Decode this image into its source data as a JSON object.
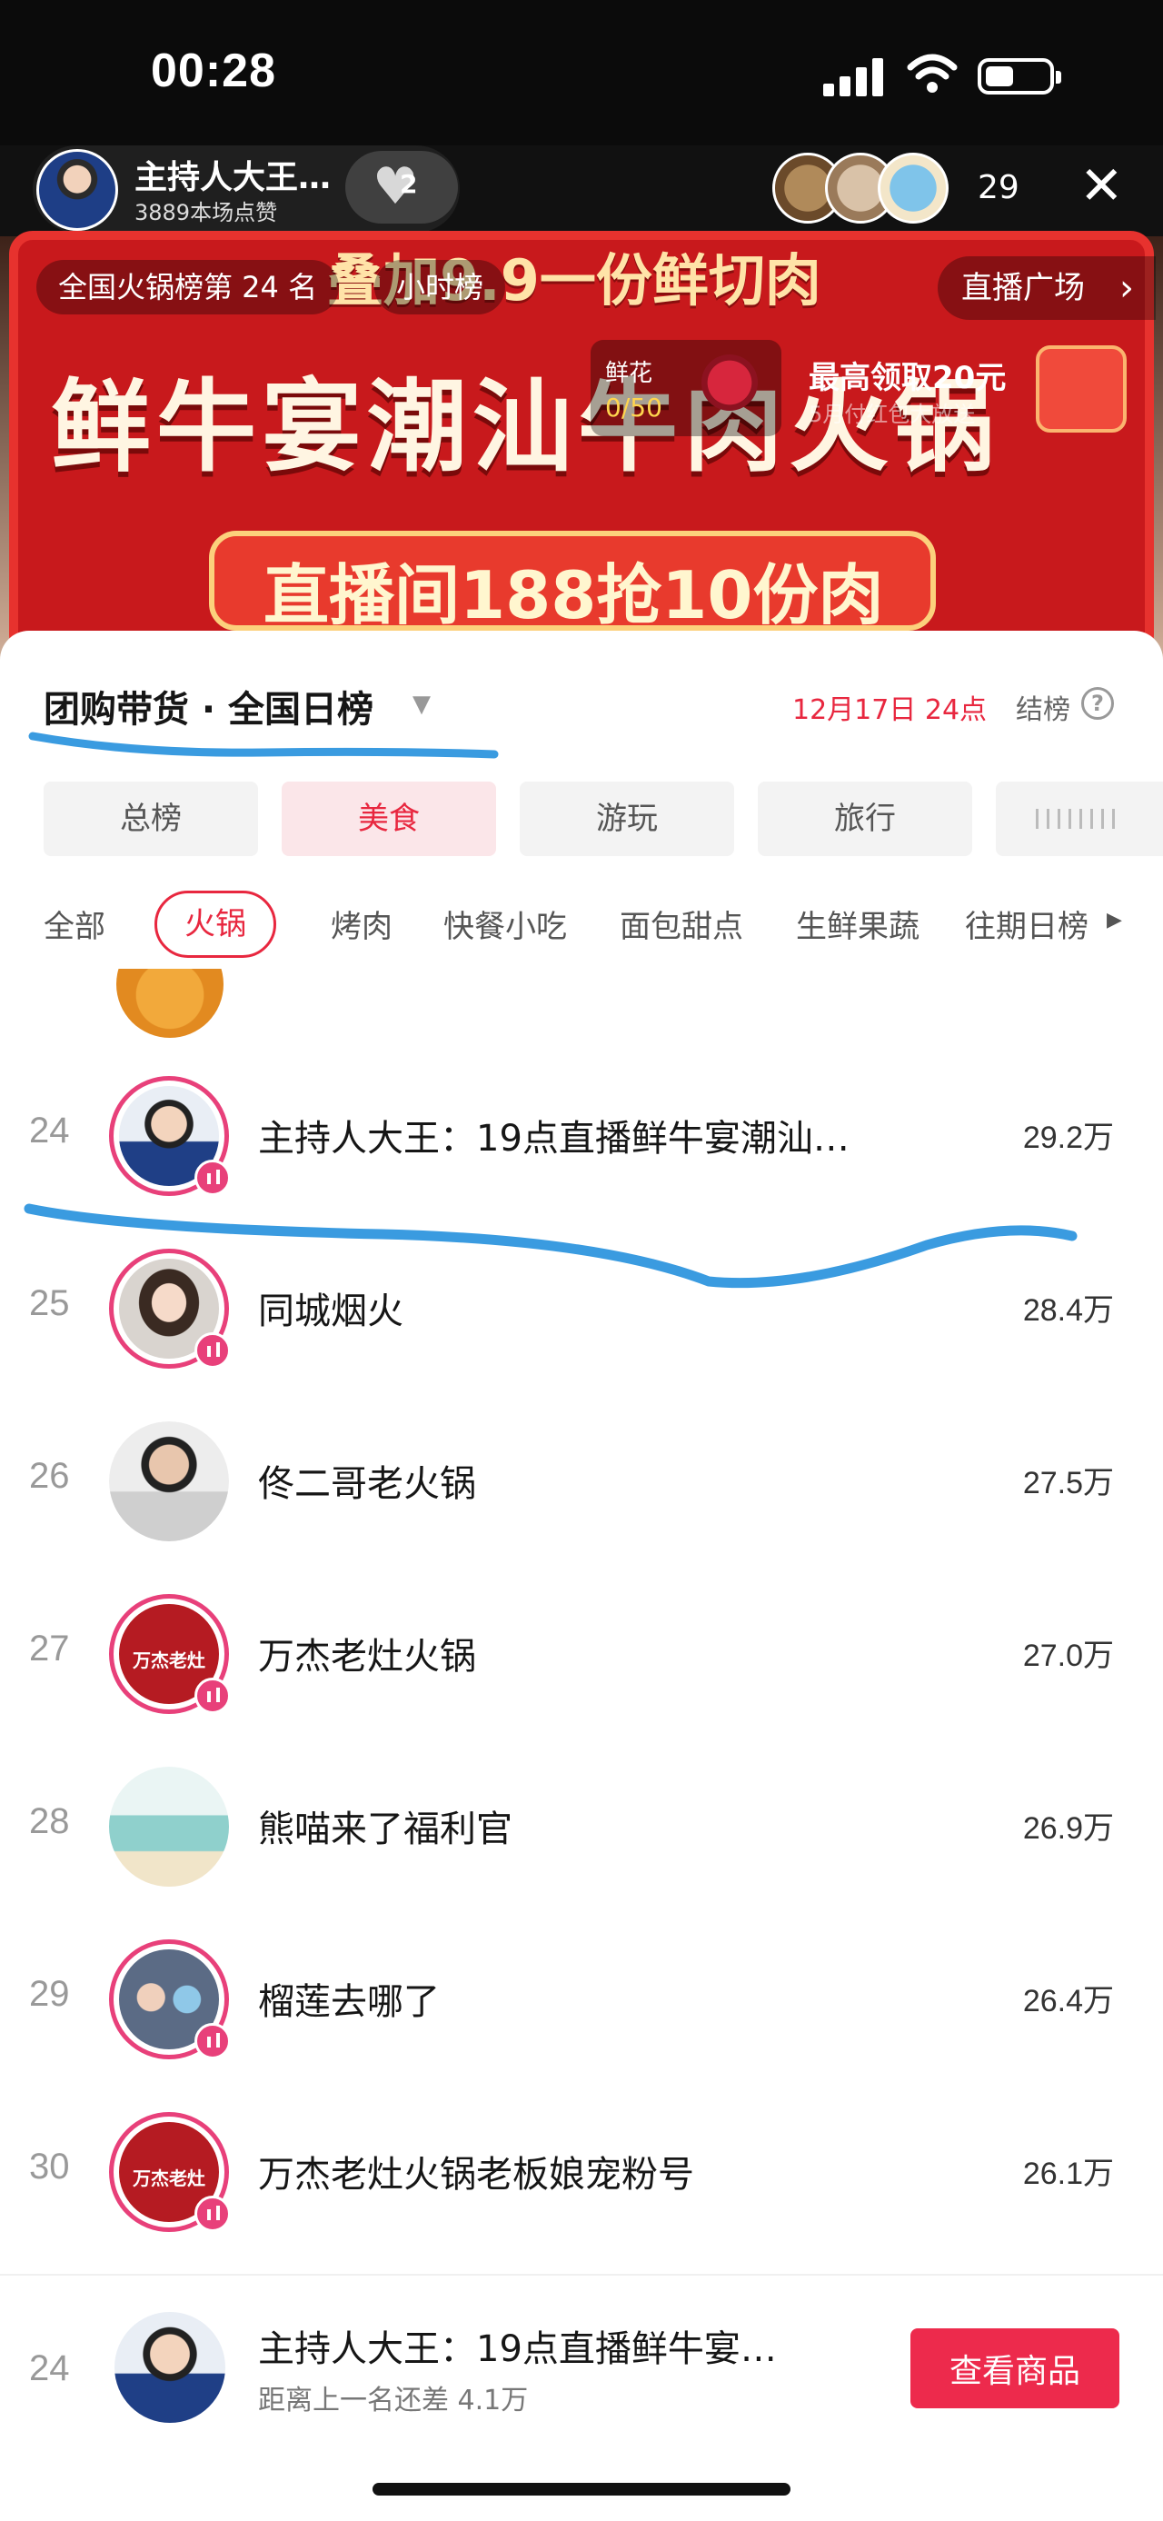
{
  "status_bar": {
    "time": "00:28"
  },
  "live": {
    "host_name": "主持人大王…",
    "likes": "3889本场点赞",
    "gift_count": "2",
    "viewer_count": "29",
    "rank_chip": "全国火锅榜第 24 名",
    "hour_chip": "小时榜",
    "plaza": "直播广场",
    "banner_top": "叠加9.9一份鲜切肉",
    "banner_main": "鲜牛宴潮汕牛肉火锅",
    "banner_bottom": "直播间188抢10份肉",
    "flower_label": "鲜花",
    "flower_count": "0/50",
    "redpack_title": "最高领取20元",
    "redpack_sub": "5月付红包大放送"
  },
  "panel": {
    "title": "团购带货 · 全国日榜",
    "date": "12月17日 24点",
    "settle": "结榜",
    "help": "?",
    "categories": [
      "总榜",
      "美食",
      "游玩",
      "旅行"
    ],
    "active_category": "美食",
    "subcategories": [
      "全部",
      "火锅",
      "烤肉",
      "快餐小吃",
      "面包甜点",
      "生鲜果蔬",
      "往期日榜"
    ],
    "active_subcategory": "火锅",
    "past_chevron": "▶"
  },
  "rows": [
    {
      "rank": "24",
      "name": "主持人大王：19点直播鲜牛宴潮汕…",
      "score": "29.2万",
      "live": true,
      "avatar": "host"
    },
    {
      "rank": "25",
      "name": "同城烟火",
      "score": "28.4万",
      "live": true,
      "avatar": "woman"
    },
    {
      "rank": "26",
      "name": "佟二哥老火锅",
      "score": "27.5万",
      "live": false,
      "avatar": "man"
    },
    {
      "rank": "27",
      "name": "万杰老灶火锅",
      "score": "27.0万",
      "live": true,
      "avatar": "wanjie",
      "logo_text": "万杰老灶"
    },
    {
      "rank": "28",
      "name": "熊喵来了福利官",
      "score": "26.9万",
      "live": false,
      "avatar": "xiongmiao"
    },
    {
      "rank": "29",
      "name": "榴莲去哪了",
      "score": "26.4万",
      "live": true,
      "avatar": "liulian"
    },
    {
      "rank": "30",
      "name": "万杰老灶火锅老板娘宠粉号",
      "score": "26.1万",
      "live": true,
      "avatar": "wanjie",
      "logo_text": "万杰老灶"
    }
  ],
  "bottom": {
    "rank": "24",
    "name": "主持人大王：19点直播鲜牛宴…",
    "gap": "距离上一名还差 4.1万",
    "cta": "查看商品"
  },
  "colors": {
    "accent_red": "#e8273f",
    "live_ring": "#e8407a",
    "cta": "#ed2a4c",
    "annotation_blue": "#3a9be0"
  }
}
